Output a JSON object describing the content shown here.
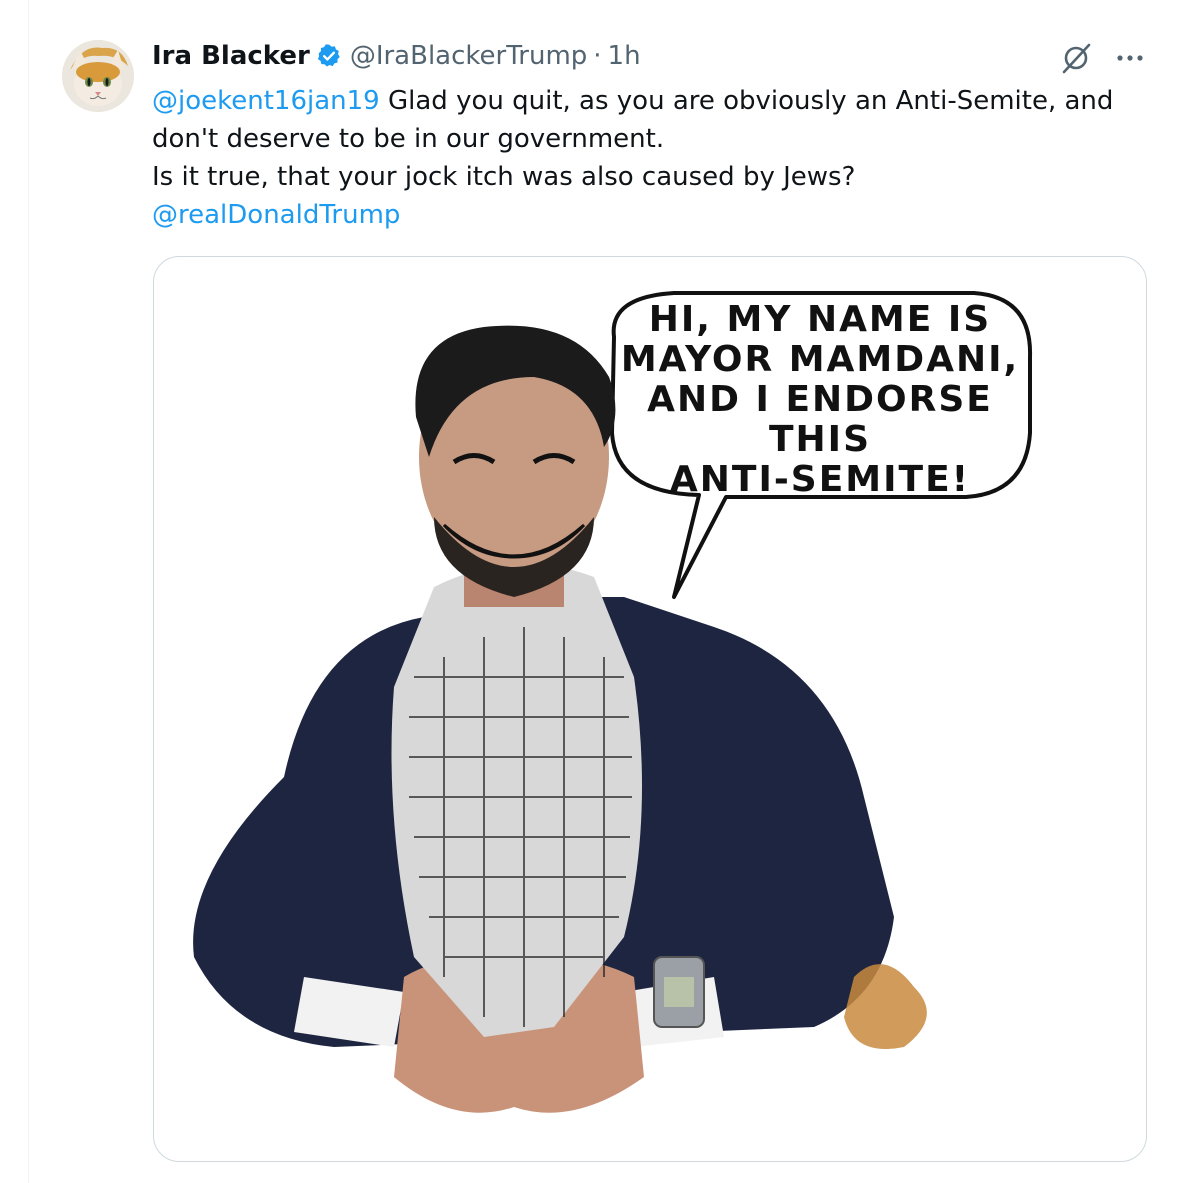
{
  "author": {
    "display_name": "Ira Blacker",
    "handle": "@IraBlackerTrump",
    "separator": "·",
    "timestamp": "1h",
    "verified": true,
    "verified_color": "#1d9bf0"
  },
  "tweet": {
    "line1_mention": "@joekent16jan19",
    "line1_text": " Glad you quit, as you are obviously an Anti-Semite, and",
    "line2_text": "don't deserve to be in our government.",
    "line3_text": "Is it true, that your jock itch was also caused by Jews?",
    "line4_mention": "@realDonaldTrump"
  },
  "media": {
    "speech_bubble_lines": [
      "HI, MY NAME IS",
      "MAYOR MAMDANI,",
      "AND I ENDORSE THIS",
      "ANTI-SEMITE!"
    ]
  },
  "icons": {
    "grok": "grok-icon",
    "more": "more-options-icon",
    "verified": "verified-badge-icon"
  },
  "colors": {
    "mention": "#1d9bf0",
    "text": "#0f1419",
    "muted": "#536471",
    "border": "#cfd9de"
  }
}
